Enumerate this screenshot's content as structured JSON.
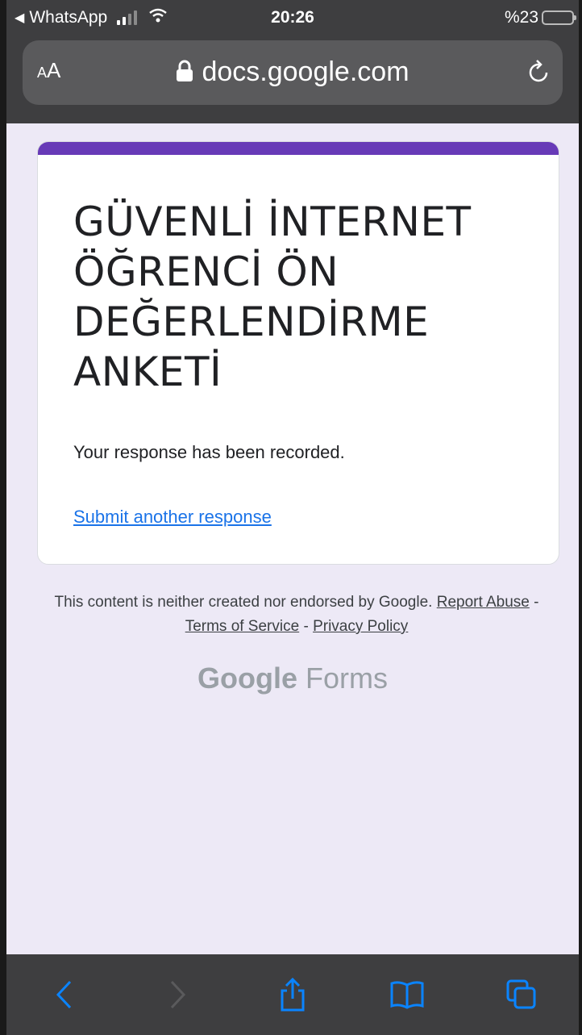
{
  "status_bar": {
    "back_app": "WhatsApp",
    "time": "20:26",
    "battery": "%23"
  },
  "address_bar": {
    "aa_label": "AA",
    "domain": "docs.google.com"
  },
  "form": {
    "title": "GÜVENLİ İNTERNET ÖĞRENCİ ÖN DEĞERLENDİRME ANKETİ",
    "confirmation": "Your response has been recorded.",
    "submit_another": "Submit another response"
  },
  "footer": {
    "disclaimer": "This content is neither created nor endorsed by Google.",
    "report_abuse": "Report Abuse",
    "terms": "Terms of Service",
    "privacy": "Privacy Policy",
    "separator": " - ",
    "logo_google": "Google",
    "logo_forms": "Forms"
  },
  "colors": {
    "accent": "#673ab7",
    "link": "#1a73e8",
    "page_bg": "#ede9f6",
    "toolbar_icon": "#0a84ff"
  },
  "toolbar_icons": [
    "back-icon",
    "forward-icon",
    "share-icon",
    "bookmarks-icon",
    "tabs-icon"
  ]
}
